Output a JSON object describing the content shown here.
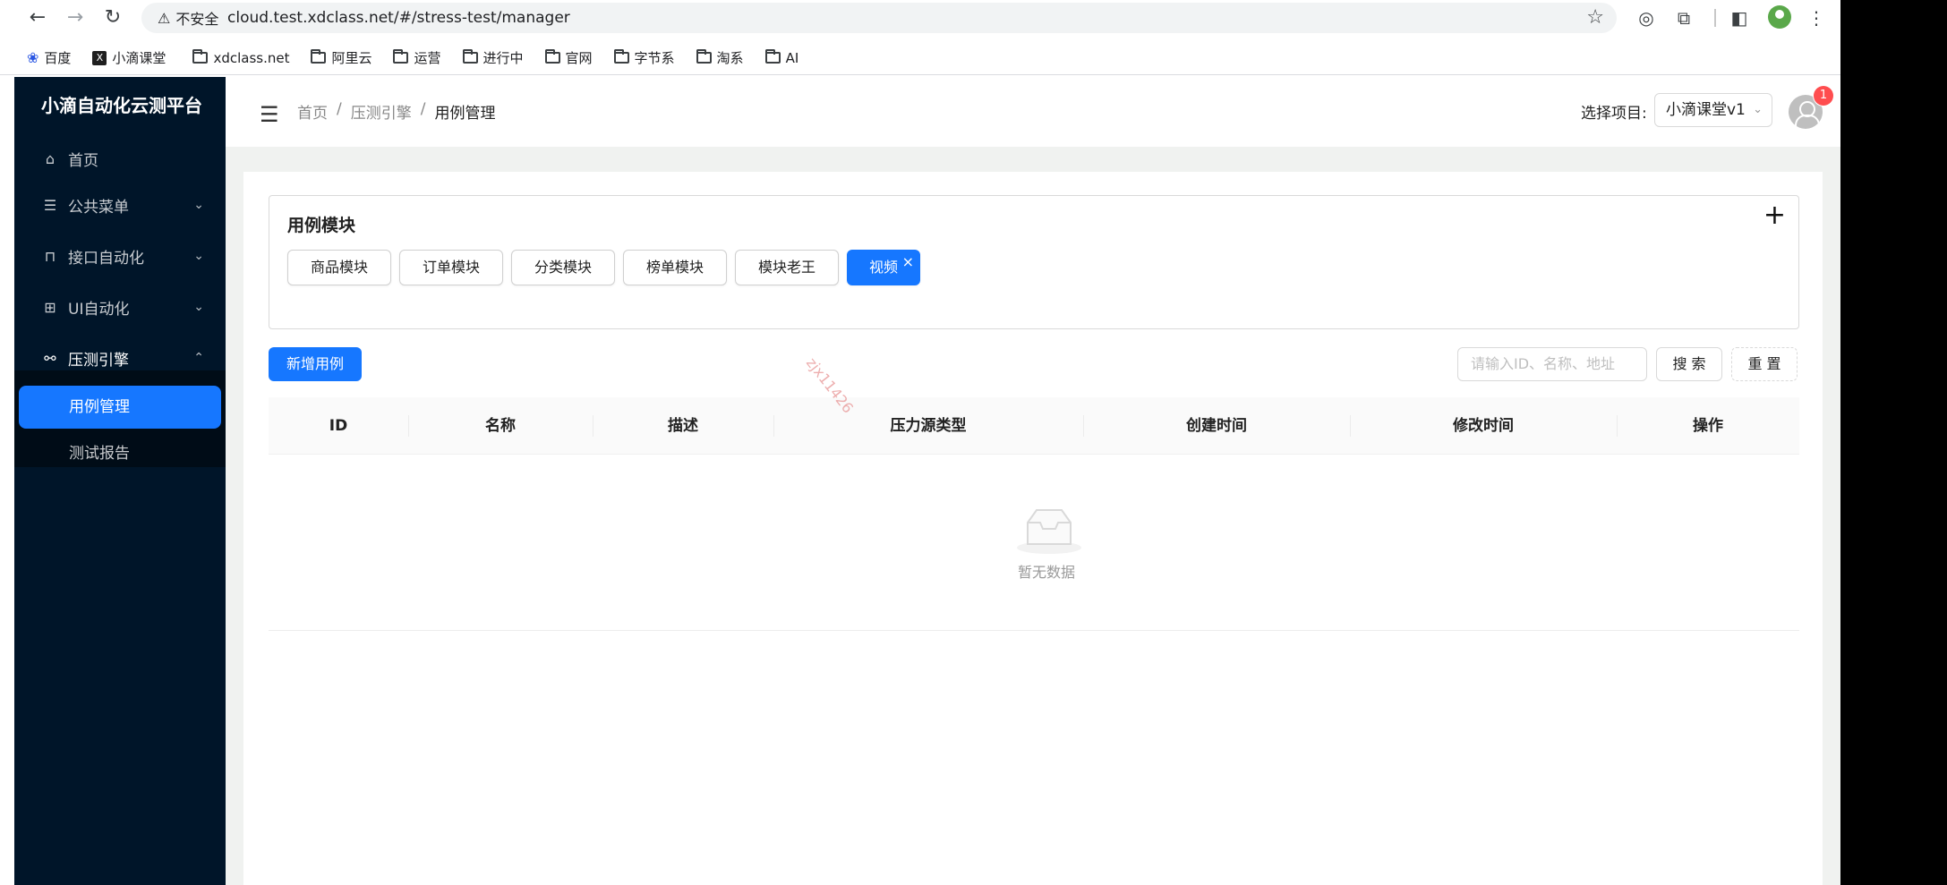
{
  "browser": {
    "security_label": "不安全",
    "url": "cloud.test.xdclass.net/#/stress-test/manager",
    "bookmarks": [
      "百度",
      "小滴课堂",
      "xdclass.net",
      "阿里云",
      "运营",
      "进行中",
      "官网",
      "字节系",
      "淘系",
      "AI"
    ]
  },
  "app": {
    "title": "小滴自动化云测平台",
    "sidebar": {
      "items": [
        {
          "label": "首页",
          "icon": "home-icon"
        },
        {
          "label": "公共菜单",
          "icon": "list-icon"
        },
        {
          "label": "接口自动化",
          "icon": "api-icon"
        },
        {
          "label": "UI自动化",
          "icon": "grid-icon"
        },
        {
          "label": "压测引擎",
          "icon": "cluster-icon"
        }
      ],
      "subitems": [
        {
          "label": "用例管理",
          "selected": true
        },
        {
          "label": "测试报告",
          "selected": false
        }
      ]
    },
    "header": {
      "breadcrumb": [
        "首页",
        "压测引擎",
        "用例管理"
      ],
      "project_label": "选择项目:",
      "project_value": "小滴课堂v1",
      "notification_count": "1"
    },
    "modules": {
      "title": "用例模块",
      "tags": [
        "商品模块",
        "订单模块",
        "分类模块",
        "榜单模块",
        "模块老王",
        "视频"
      ],
      "selected": "视频"
    },
    "toolbar": {
      "add_label": "新增用例",
      "search_placeholder": "请输入ID、名称、地址",
      "search_label": "搜 索",
      "reset_label": "重 置"
    },
    "table": {
      "columns": [
        "ID",
        "名称",
        "描述",
        "压力源类型",
        "创建时间",
        "修改时间",
        "操作"
      ],
      "empty_text": "暂无数据"
    },
    "watermark": "zjx11426"
  },
  "colors": {
    "sidebar_bg": "#001529",
    "primary": "#1677ff",
    "badge": "#ff4d4f"
  }
}
